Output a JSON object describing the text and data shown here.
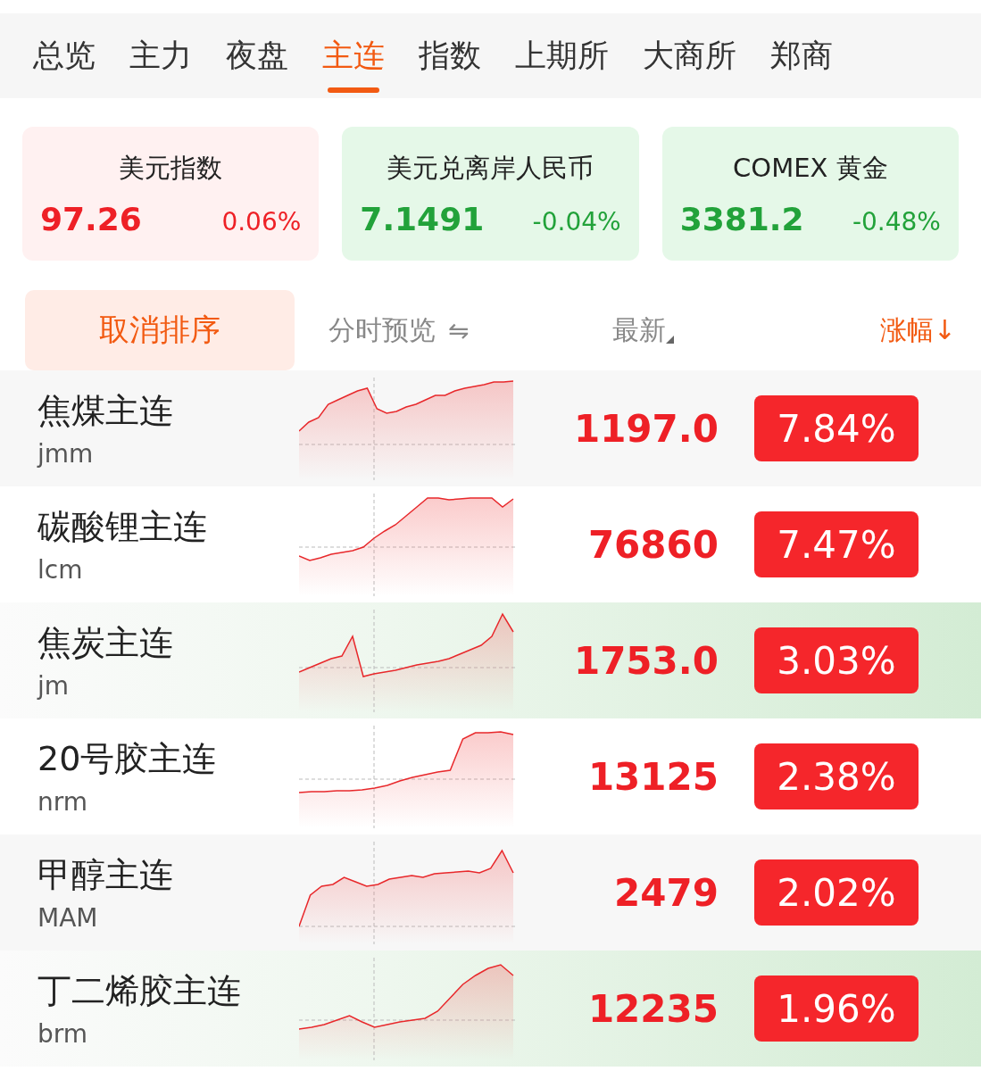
{
  "tabs": [
    {
      "label": "总览",
      "selected": false
    },
    {
      "label": "主力",
      "selected": false
    },
    {
      "label": "夜盘",
      "selected": false
    },
    {
      "label": "主连",
      "selected": true
    },
    {
      "label": "指数",
      "selected": false
    },
    {
      "label": "上期所",
      "selected": false
    },
    {
      "label": "大商所",
      "selected": false
    },
    {
      "label": "郑商",
      "selected": false
    }
  ],
  "indices": [
    {
      "name": "美元指数",
      "price": "97.26",
      "change": "0.06%",
      "rising": true
    },
    {
      "name": "美元兑离岸人民币",
      "price": "7.1491",
      "change": "-0.04%",
      "rising": false
    },
    {
      "name": "COMEX 黄金",
      "price": "3381.2",
      "change": "-0.48%",
      "rising": false
    }
  ],
  "list_header": {
    "cancel_sort": "取消排序",
    "preview": "分时预览",
    "preview_toggle": "⇋",
    "latest": "最新",
    "change": "涨幅↓"
  },
  "rows": [
    {
      "name": "焦煤主连",
      "code": "jmm",
      "price": "1197.0",
      "change": "7.84%",
      "highlighted": false
    },
    {
      "name": "碳酸锂主连",
      "code": "lcm",
      "price": "76860",
      "change": "7.47%",
      "highlighted": false
    },
    {
      "name": "焦炭主连",
      "code": "jm",
      "price": "1753.0",
      "change": "3.03%",
      "highlighted": true
    },
    {
      "name": "20号胶主连",
      "code": "nrm",
      "price": "13125",
      "change": "2.38%",
      "highlighted": false
    },
    {
      "name": "甲醇主连",
      "code": "MAM",
      "price": "2479",
      "change": "2.02%",
      "highlighted": false
    },
    {
      "name": "丁二烯胶主连",
      "code": "brm",
      "price": "12235",
      "change": "1.96%",
      "highlighted": true
    }
  ]
}
